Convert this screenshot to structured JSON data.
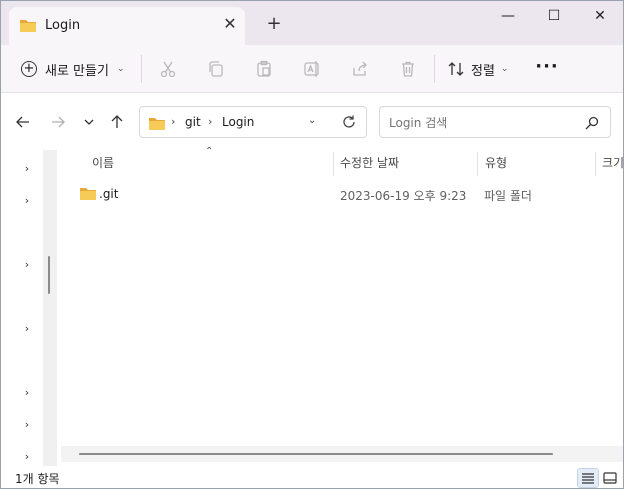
{
  "tab": {
    "title": "Login",
    "close_glyph": "✕"
  },
  "new_tab_glyph": "+",
  "window_controls": {
    "minimize": "—",
    "maximize": "☐",
    "close": "✕"
  },
  "command_bar": {
    "new_label": "새로 만들기",
    "sort_label": "정렬",
    "more_glyph": "···",
    "icons": [
      "cut-icon",
      "copy-icon",
      "paste-icon",
      "rename-icon",
      "share-icon",
      "delete-icon"
    ]
  },
  "address": {
    "crumbs": [
      "git",
      "Login"
    ],
    "separator": "›"
  },
  "search": {
    "placeholder": "Login 검색"
  },
  "columns": {
    "name": "이름",
    "modified": "수정한 날짜",
    "type": "유형",
    "size": "크기"
  },
  "files": [
    {
      "name": ".git",
      "modified": "2023-06-19 오후 9:23",
      "type": "파일 폴더"
    }
  ],
  "status": {
    "item_count": "1개 항목"
  },
  "colors": {
    "folder": "#f3c34a",
    "accent": "#0067c0",
    "titlebar": "#ece7ef"
  }
}
